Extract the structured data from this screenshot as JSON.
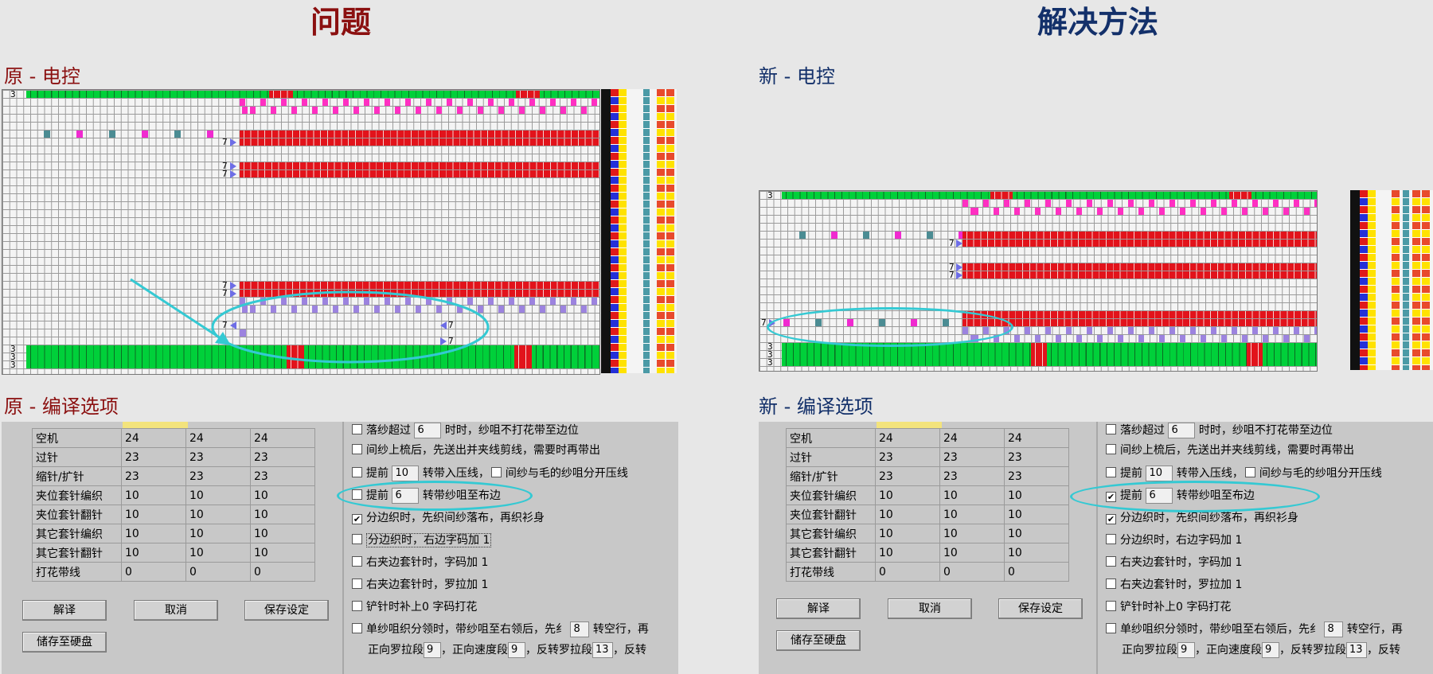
{
  "header": {
    "problem_title": "问题",
    "solution_title": "解决方法"
  },
  "left": {
    "editor_title": "原 - 电控",
    "options_title": "原 - 编译选项"
  },
  "right": {
    "editor_title": "新 - 电控",
    "options_title": "新 - 编译选项"
  },
  "editor_marks": {
    "row_number": "3",
    "seven": "7"
  },
  "options_table": {
    "rows": [
      {
        "label": "空机",
        "v1": "24",
        "v2": "24",
        "v3": "24"
      },
      {
        "label": "过针",
        "v1": "23",
        "v2": "23",
        "v3": "23"
      },
      {
        "label": "缩针/扩针",
        "v1": "23",
        "v2": "23",
        "v3": "23"
      },
      {
        "label": "夹位套针编织",
        "v1": "10",
        "v2": "10",
        "v3": "10"
      },
      {
        "label": "夹位套针翻针",
        "v1": "10",
        "v2": "10",
        "v3": "10"
      },
      {
        "label": "其它套针编织",
        "v1": "10",
        "v2": "10",
        "v3": "10"
      },
      {
        "label": "其它套针翻针",
        "v1": "10",
        "v2": "10",
        "v3": "10"
      },
      {
        "label": "打花带线",
        "v1": "0",
        "v2": "0",
        "v3": "0"
      }
    ]
  },
  "buttons": {
    "compile": "解译",
    "cancel": "取消",
    "save_settings": "保存设定",
    "save_to_disk": "储存至硬盘"
  },
  "options": {
    "opt1_a": "落纱超过",
    "opt1_val": "6",
    "opt1_b": "时时，纱咀不打花带至边位",
    "opt2": "间纱上梳后，先送出并夹线剪线，需要时再带出",
    "opt3_a": "提前",
    "opt3_val": "10",
    "opt3_b": "转带入压线，",
    "opt3_c": "间纱与毛的纱咀分开压线",
    "opt4_a": "提前",
    "opt4_val": "6",
    "opt4_b": "转带纱咀至布边",
    "opt5": "分边织时，先织间纱落布，再织衫身",
    "opt6": "分边织时，右边字码加 1",
    "opt7": "右夹边套针时，字码加 1",
    "opt8": "右夹边套针时，罗拉加 1",
    "opt9": "铲针时补上0 字码打花",
    "opt10_a": "单纱咀织分领时，带纱咀至右领后，先纟",
    "opt10_val": "8",
    "opt10_b": "转空行，再",
    "opt11_a": "正向罗拉段",
    "opt11_v1": "9",
    "opt11_b": "，正向速度段",
    "opt11_v2": "9",
    "opt11_c": "，反转罗拉段",
    "opt11_v3": "13",
    "opt11_d": "，反转",
    "left_check_opt4": false,
    "right_check_opt4": true,
    "check_opt5": true
  },
  "colors": {
    "problem_red": "#8b1010",
    "solution_blue": "#13306a",
    "highlight_ring": "#34c9d3"
  }
}
